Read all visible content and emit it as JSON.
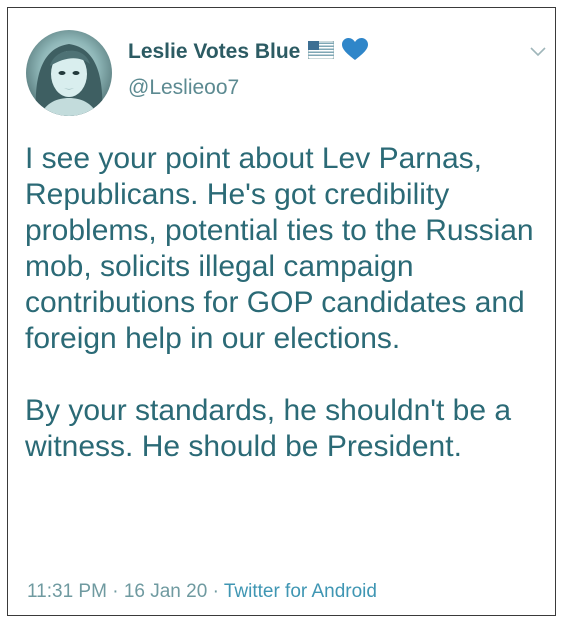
{
  "tweet": {
    "display_name": "Leslie Votes Blue",
    "handle": "@Leslieoo7",
    "paragraphs": [
      "I see your point about Lev Parnas, Republicans. He's got credibility problems, potential ties to the Russian mob, solicits illegal campaign contributions for GOP candidates and foreign help in our elections.",
      "By your standards, he shouldn't be a witness. He should be President."
    ],
    "time": "11:31 PM",
    "date": "16 Jan 20",
    "separator": "·",
    "source": "Twitter for Android",
    "icons": {
      "flag": "us-flag-icon",
      "heart": "blue-heart-icon",
      "menu": "chevron-down-icon"
    }
  },
  "colors": {
    "name": "#2c5b63",
    "handle": "#5c8a91",
    "body": "#2b6a76",
    "meta": "#6f9aa0",
    "source": "#3f96b3",
    "heart": "#2f86c9"
  }
}
